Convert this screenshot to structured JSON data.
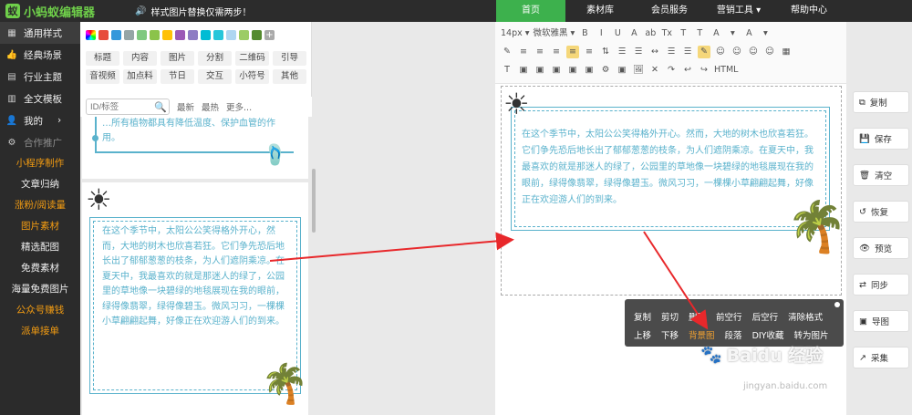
{
  "brand": {
    "name": "小蚂蚁编辑器",
    "logo_char": "蚁"
  },
  "notice": "样式图片替换仅需两步！",
  "topnav": [
    {
      "label": "首页",
      "active": true
    },
    {
      "label": "素材库"
    },
    {
      "label": "会员服务"
    },
    {
      "label": "营销工具 ▾"
    },
    {
      "label": "帮助中心"
    }
  ],
  "sidebar": {
    "items": [
      {
        "label": "通用样式",
        "icon": "grid-icon",
        "glyph": "▦",
        "active": true
      },
      {
        "label": "经典场景",
        "icon": "thumb-icon",
        "glyph": "👍"
      },
      {
        "label": "行业主题",
        "icon": "doc-icon",
        "glyph": "▤"
      },
      {
        "label": "全文模板",
        "icon": "book-icon",
        "glyph": "▥"
      },
      {
        "label": "我的",
        "icon": "user-icon",
        "glyph": "👤",
        "chevron": "›"
      }
    ],
    "section": "合作推广",
    "links": [
      {
        "label": "小程序制作",
        "orange": true
      },
      {
        "label": "文章归纳"
      },
      {
        "label": "涨粉/阅读量",
        "orange": true
      },
      {
        "label": "图片素材",
        "orange": true
      },
      {
        "label": "精选配图"
      },
      {
        "label": "免费素材"
      },
      {
        "label": "海量免费图片"
      },
      {
        "label": "公众号赚钱",
        "orange": true
      },
      {
        "label": "派单接单",
        "orange": true
      }
    ]
  },
  "palette": {
    "colors": [
      "#e74c3c",
      "#3498db",
      "#95a5a6",
      "#7fc97f",
      "#8bc34a",
      "#ffc107",
      "#9b59b6",
      "#8e7cc3",
      "#00bcd4",
      "#26c6da",
      "#aed6f1",
      "#9ccc65",
      "#558b2f"
    ],
    "add_label": "+"
  },
  "categories": [
    "标题",
    "内容",
    "图片",
    "分割",
    "二维码",
    "引导",
    "音视频",
    "加点料",
    "节日",
    "交互",
    "小符号",
    "其他"
  ],
  "search": {
    "placeholder": "ID/标签",
    "sort": [
      "最新",
      "最热",
      "更多..."
    ]
  },
  "template": {
    "card1_text": "…所有植物都具有降低温度、保护血管的作用。",
    "card2_text": "在这个季节中，太阳公公笑得格外开心，然而，大地的树木也欣喜若狂。它们争先恐后地长出了郁郁葱葱的枝条，为人们遮阴乘凉。在夏天中，我最喜欢的就是那迷人的绿了，公园里的草地像一块碧绿的地毯展现在我的眼前，绿得像翡翠，绿得像碧玉。微风习习，一棵棵小草翩翩起舞，好像正在欢迎游人们的到来。"
  },
  "toolbar": {
    "row1": [
      "14px ▾",
      "微软雅黑 ▾",
      "B",
      "I",
      "U",
      "A",
      "ab",
      "Tx",
      "T",
      "T",
      "A",
      "▾",
      "A",
      "▾"
    ],
    "row2": [
      "✎",
      "≡",
      "≡",
      "≡",
      "≡",
      "≡",
      "⇅",
      "☰",
      "☰",
      "↔",
      "☰",
      "☰",
      "✎",
      "☺",
      "☺",
      "☺",
      "☺",
      "▦"
    ],
    "row3": [
      "T",
      "▣",
      "▣",
      "▣",
      "▣",
      "▣",
      "⚙",
      "▣",
      "🖼",
      "✕",
      "↷",
      "↩",
      "↪",
      "HTML"
    ]
  },
  "document": {
    "text": "在这个季节中，太阳公公笑得格外开心。然而，大地的树木也欣喜若狂。它们争先恐后地长出了郁郁葱葱的枝条，为人们遮阴乘凉。在夏天中，我最喜欢的就是那迷人的绿了，公园里的草地像一块碧绿的地毯展现在我的眼前，绿得像翡翠，绿得像碧玉。微风习习，一棵棵小草翩翩起舞，好像正在欢迎游人们的到来。"
  },
  "right_tools": [
    {
      "label": "复制",
      "icon": "copy-icon",
      "glyph": "⧉"
    },
    {
      "label": "保存",
      "icon": "save-icon",
      "glyph": "💾"
    },
    {
      "label": "清空",
      "icon": "trash-icon",
      "glyph": "🗑"
    },
    {
      "label": "恢复",
      "icon": "restore-icon",
      "glyph": "↺"
    },
    {
      "label": "预览",
      "icon": "eye-icon",
      "glyph": "👁"
    },
    {
      "label": "同步",
      "icon": "sync-icon",
      "glyph": "⇄"
    },
    {
      "label": "导图",
      "icon": "export-image-icon",
      "glyph": "▣"
    },
    {
      "label": "采集",
      "icon": "collect-icon",
      "glyph": "↗"
    }
  ],
  "context_menu": {
    "row1": [
      "复制",
      "剪切",
      "删除",
      "前空行",
      "后空行",
      "清除格式"
    ],
    "row2": [
      "上移",
      "下移",
      "背景图",
      "段落",
      "DIY收藏",
      "转为图片"
    ],
    "highlight": "背景图"
  },
  "watermark": {
    "brand": "Baidu 经验",
    "url": "jingyan.baidu.com"
  },
  "colors": {
    "accent": "#3db14d",
    "template_text": "#5ab2cc",
    "arrow": "#e8282b",
    "orange": "#f39c12"
  }
}
